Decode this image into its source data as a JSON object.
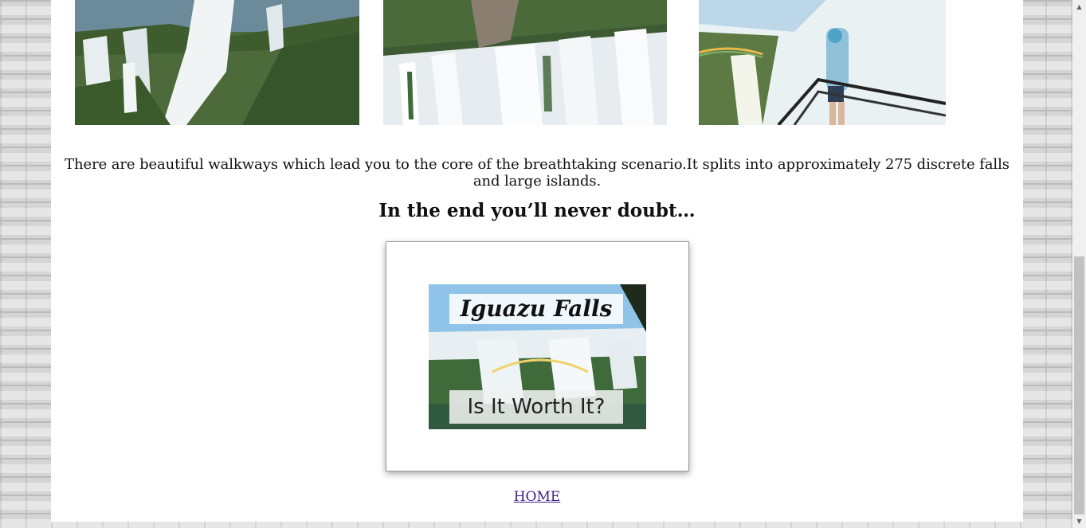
{
  "intro_text": "There are beautiful walkways which lead you to the core of the breathtaking scenario.It splits into approximately 275 discrete falls and large islands.",
  "section_heading": "In the end you’ll never doubt…",
  "banner": {
    "title": "Iguazu Falls",
    "subtitle": "Is It Worth It?"
  },
  "home_link": "HOME",
  "scrollbar": {
    "up_icon": "▲",
    "down_icon": "▼",
    "position_fraction": 0.49
  }
}
